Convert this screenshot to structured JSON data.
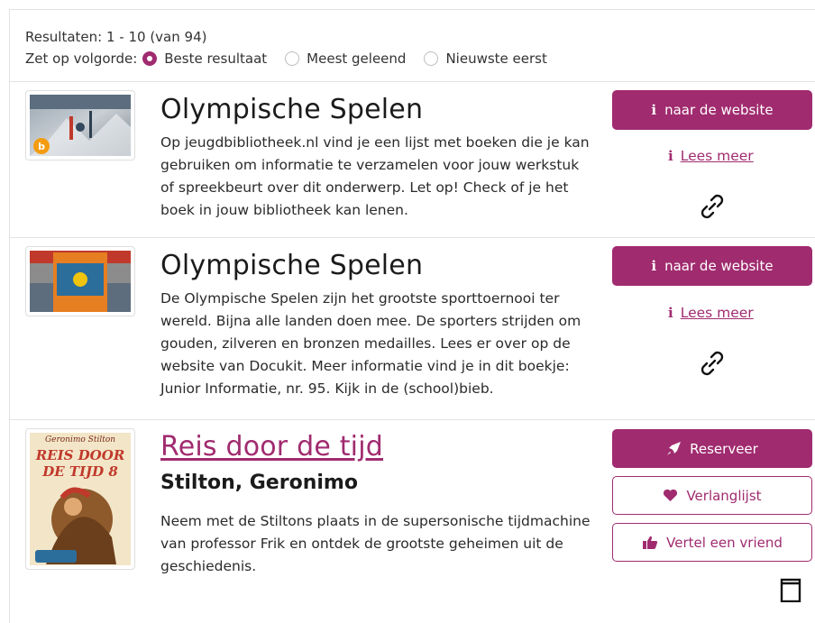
{
  "results": {
    "summary": "Resultaten: 1 - 10 (van 94)",
    "sort_label": "Zet op volgorde:",
    "sort_options": [
      "Beste resultaat",
      "Meest geleend",
      "Nieuwste eerst"
    ],
    "sort_selected": "Beste resultaat"
  },
  "items": [
    {
      "title": "Olympische Spelen",
      "description": "Op jeugdbibliotheek.nl vind je een lijst met boeken die je kan gebruiken om informatie te verzamelen voor jouw werkstuk of spreekbeurt over dit onderwerp. Let op! Check of je het boek in jouw bibliotheek kan lenen.",
      "website_button": "naar de website",
      "read_more": "Lees meer"
    },
    {
      "title": "Olympische Spelen",
      "description": "De Olympische Spelen zijn het grootste sporttoernooi ter wereld. Bijna alle landen doen mee. De sporters strijden om gouden, zilveren en bronzen medailles. Lees er over op de website van Docukit. Meer informatie vind je in dit boekje: Junior Informatie, nr. 95. Kijk in de (school)bieb.",
      "website_button": "naar de website",
      "read_more": "Lees meer"
    },
    {
      "title": "Reis door de tijd",
      "author": "Stilton, Geronimo",
      "description": "Neem met de Stiltons plaats in de supersonische tijdmachine van professor Frik en ontdek de grootste geheimen uit de geschiedenis.",
      "reserve_button": "Reserveer",
      "wishlist_button": "Verlanglijst",
      "tell_friend_button": "Vertel een vriend",
      "cover_text": {
        "series": "Geronimo Stilton",
        "title_line1": "REIS DOOR",
        "title_line2": "DE TIJD 8"
      }
    }
  ],
  "colors": {
    "accent": "#a02b6f"
  },
  "icons": [
    "info-icon",
    "link-icon",
    "rocket-icon",
    "heart-icon",
    "thumbs-up-icon",
    "book-icon"
  ]
}
